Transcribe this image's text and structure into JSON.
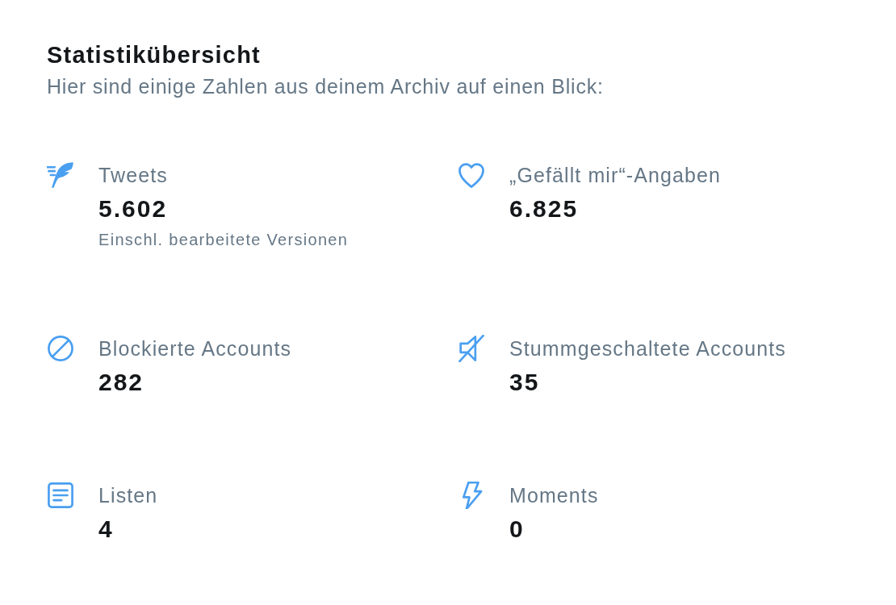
{
  "header": {
    "title": "Statistikübersicht",
    "subtitle": "Hier sind einige Zahlen aus deinem Archiv auf einen Blick:"
  },
  "stats": [
    {
      "label": "Tweets",
      "value": "5.602",
      "note": "Einschl. bearbeitete Versionen"
    },
    {
      "label": "„Gefällt mir“-Angaben",
      "value": "6.825"
    },
    {
      "label": "Blockierte Accounts",
      "value": "282"
    },
    {
      "label": "Stummgeschaltete Accounts",
      "value": "35"
    },
    {
      "label": "Listen",
      "value": "4"
    },
    {
      "label": "Moments",
      "value": "0"
    }
  ]
}
